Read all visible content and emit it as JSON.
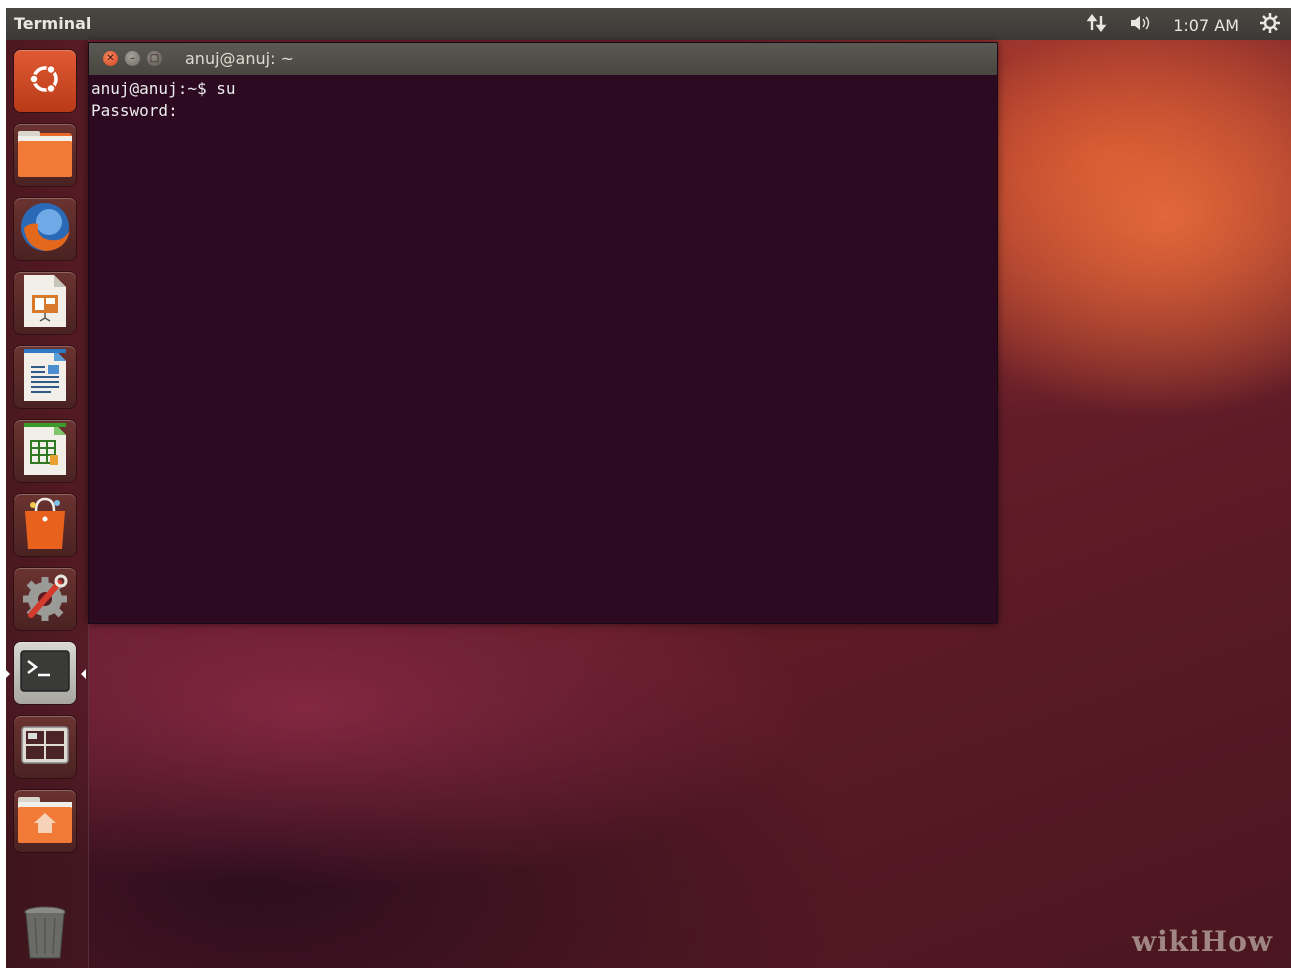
{
  "top_panel": {
    "app_title": "Terminal",
    "time": "1:07 AM",
    "icons": [
      "network-icon",
      "volume-icon",
      "session-gear-icon"
    ]
  },
  "launcher": {
    "items": [
      {
        "name": "dash-home",
        "icon": "ubuntu-logo-icon"
      },
      {
        "name": "files",
        "icon": "folder-icon"
      },
      {
        "name": "firefox",
        "icon": "firefox-icon"
      },
      {
        "name": "libreoffice-impress",
        "icon": "presentation-icon"
      },
      {
        "name": "libreoffice-writer",
        "icon": "document-icon"
      },
      {
        "name": "libreoffice-calc",
        "icon": "spreadsheet-icon"
      },
      {
        "name": "software-center",
        "icon": "shopping-bag-icon"
      },
      {
        "name": "system-settings",
        "icon": "settings-gear-icon"
      },
      {
        "name": "terminal",
        "icon": "terminal-icon",
        "active": true
      },
      {
        "name": "workspace-switcher",
        "icon": "workspaces-icon"
      },
      {
        "name": "home-folder",
        "icon": "home-folder-icon"
      },
      {
        "name": "trash",
        "icon": "trash-icon"
      }
    ]
  },
  "terminal_window": {
    "title": "anuj@anuj: ~",
    "lines": [
      "anuj@anuj:~$ su",
      "Password:"
    ]
  },
  "watermark": {
    "text_wiki": "wiki",
    "text_how": "How"
  },
  "colors": {
    "terminal_bg": "#2c0a22",
    "close_button": "#e0542d",
    "panel_bg": "#3b3a36"
  }
}
